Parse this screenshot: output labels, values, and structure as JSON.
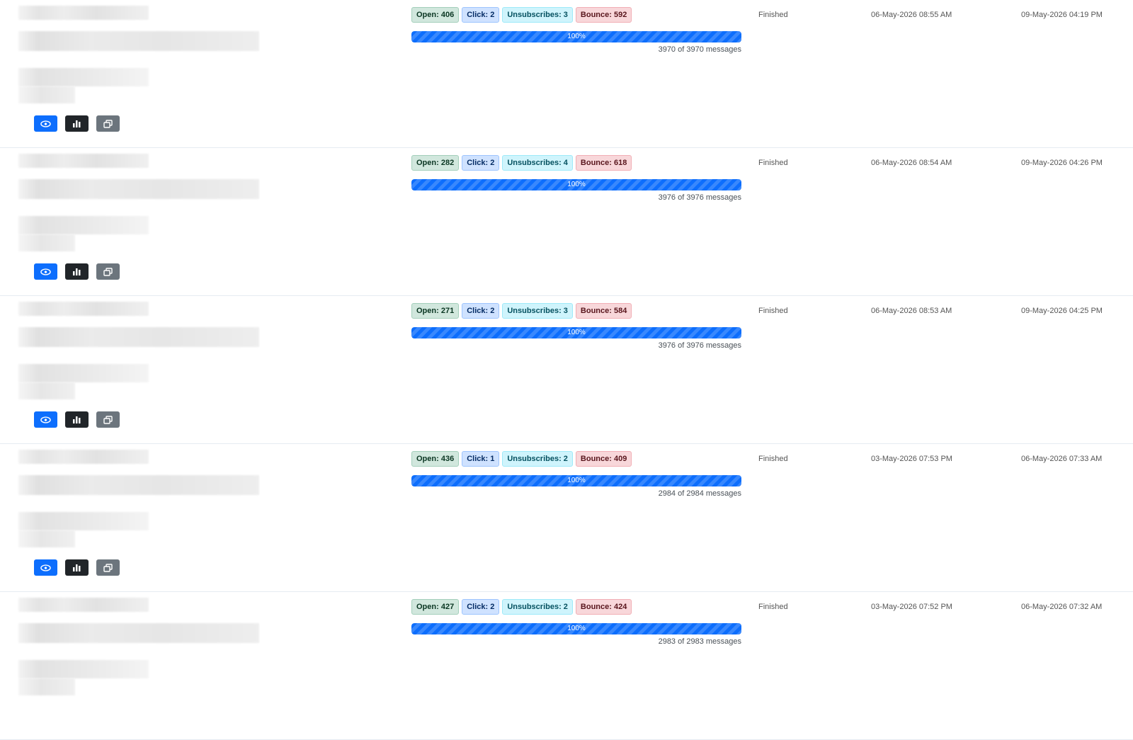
{
  "icons": {
    "view": "eye-icon",
    "stats": "bar-chart-icon",
    "duplicate": "copy-icon"
  },
  "colors": {
    "primary": "#0d6efd",
    "dark": "#212529",
    "secondary": "#6c757d",
    "success_bg": "#d1e7dd",
    "info_bg": "#cff4fc",
    "danger_bg": "#f8d7da"
  },
  "campaigns": [
    {
      "open": "Open: 406",
      "click": "Click: 2",
      "unsubscribes": "Unsubscribes: 3",
      "bounce": "Bounce: 592",
      "progress_label": "100%",
      "progress": 1.0,
      "messages": "3970 of 3970 messages",
      "status": "Finished",
      "started": "06-May-2026 08:55 AM",
      "finished": "09-May-2026 04:19 PM"
    },
    {
      "open": "Open: 282",
      "click": "Click: 2",
      "unsubscribes": "Unsubscribes: 4",
      "bounce": "Bounce: 618",
      "progress_label": "100%",
      "progress": 1.0,
      "messages": "3976 of 3976 messages",
      "status": "Finished",
      "started": "06-May-2026 08:54 AM",
      "finished": "09-May-2026 04:26 PM"
    },
    {
      "open": "Open: 271",
      "click": "Click: 2",
      "unsubscribes": "Unsubscribes: 3",
      "bounce": "Bounce: 584",
      "progress_label": "100%",
      "progress": 1.0,
      "messages": "3976 of 3976 messages",
      "status": "Finished",
      "started": "06-May-2026 08:53 AM",
      "finished": "09-May-2026 04:25 PM"
    },
    {
      "open": "Open: 436",
      "click": "Click: 1",
      "unsubscribes": "Unsubscribes: 2",
      "bounce": "Bounce: 409",
      "progress_label": "100%",
      "progress": 1.0,
      "messages": "2984 of 2984 messages",
      "status": "Finished",
      "started": "03-May-2026 07:53 PM",
      "finished": "06-May-2026 07:33 AM"
    },
    {
      "open": "Open: 427",
      "click": "Click: 2",
      "unsubscribes": "Unsubscribes: 2",
      "bounce": "Bounce: 424",
      "progress_label": "100%",
      "progress": 1.0,
      "messages": "2983 of 2983 messages",
      "status": "Finished",
      "started": "03-May-2026 07:52 PM",
      "finished": "06-May-2026 07:32 AM"
    }
  ]
}
